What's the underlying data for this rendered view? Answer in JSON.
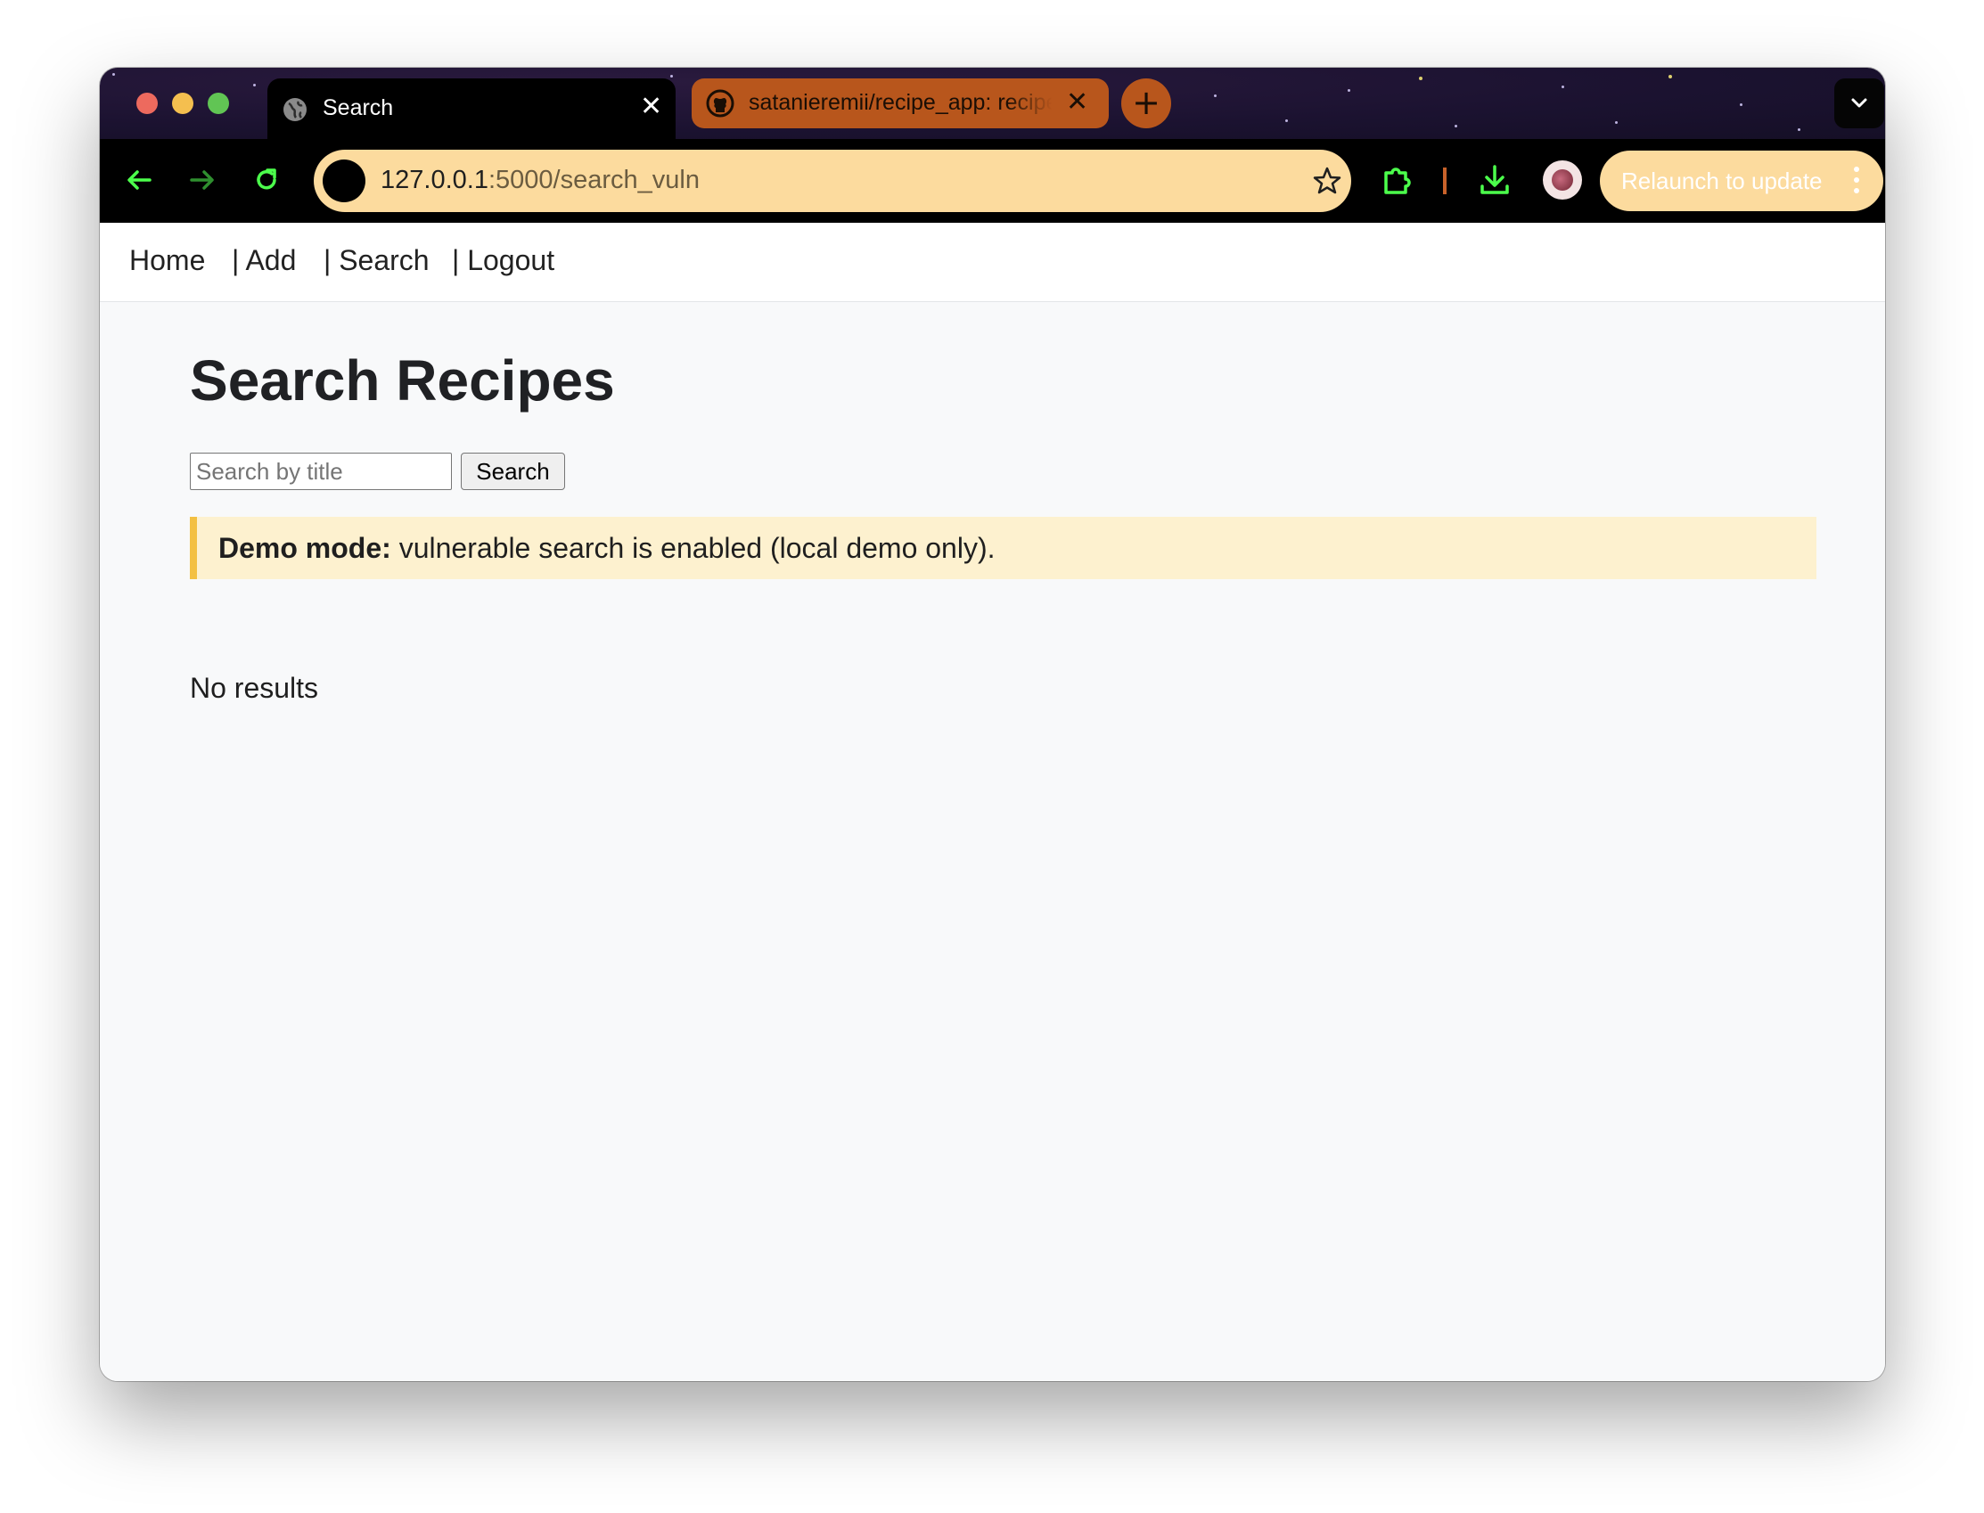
{
  "browser": {
    "tabs": [
      {
        "title": "Search",
        "active": true,
        "icon": "globe-icon"
      },
      {
        "title": "satanieremii/recipe_app: recipe",
        "active": false,
        "icon": "github-icon"
      }
    ],
    "close_glyph": "✕",
    "new_tab_glyph": "+",
    "address": {
      "host": "127.0.0.1",
      "path": ":5000/search_vuln"
    },
    "relaunch_label": "Relaunch to update",
    "colors": {
      "tabbar_bg": "#1b1230",
      "inactive_tab": "#b8561c",
      "omnibox": "#fcdb9e",
      "toolbar_icon": "#4cff4c",
      "toolbar_bg": "#000000"
    }
  },
  "nav": {
    "home": "Home",
    "add": "| Add",
    "search": "| Search",
    "logout": "| Logout"
  },
  "page": {
    "title": "Search Recipes",
    "search": {
      "placeholder": "Search by title",
      "value": "",
      "button_label": "Search"
    },
    "alert": {
      "bold": "Demo mode:",
      "text": " vulnerable search is enabled (local demo only).",
      "bg": "#fdf1cf",
      "border": "#f3c042"
    },
    "results_text": "No results"
  }
}
